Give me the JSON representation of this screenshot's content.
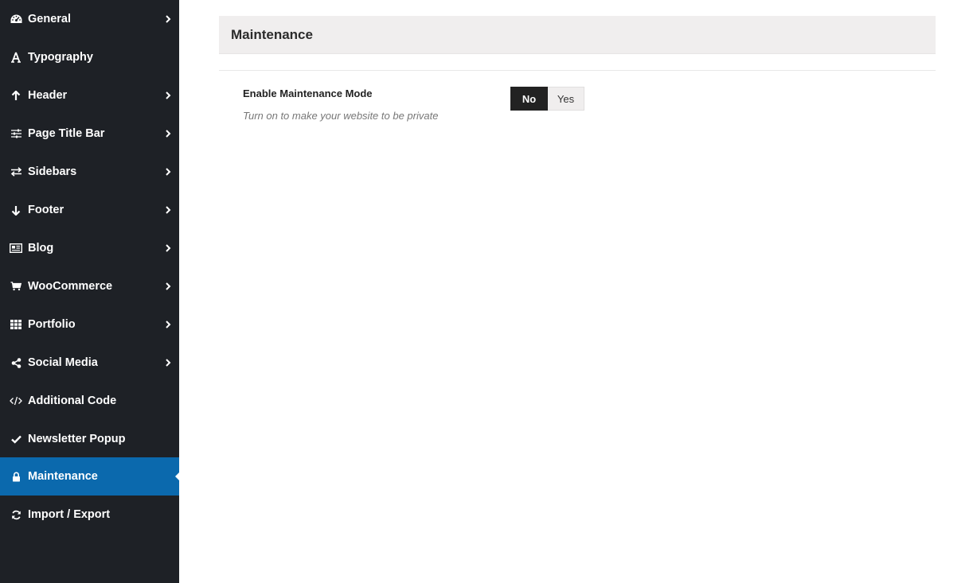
{
  "sidebar": {
    "items": [
      {
        "label": "General",
        "icon": "dashboard-icon",
        "has_submenu": true
      },
      {
        "label": "Typography",
        "icon": "typography-icon",
        "has_submenu": false
      },
      {
        "label": "Header",
        "icon": "arrow-up-icon",
        "has_submenu": true
      },
      {
        "label": "Page Title Bar",
        "icon": "sliders-icon",
        "has_submenu": true
      },
      {
        "label": "Sidebars",
        "icon": "exchange-icon",
        "has_submenu": true
      },
      {
        "label": "Footer",
        "icon": "arrow-down-icon",
        "has_submenu": true
      },
      {
        "label": "Blog",
        "icon": "newspaper-icon",
        "has_submenu": true
      },
      {
        "label": "WooCommerce",
        "icon": "cart-icon",
        "has_submenu": true
      },
      {
        "label": "Portfolio",
        "icon": "grid-icon",
        "has_submenu": true
      },
      {
        "label": "Social Media",
        "icon": "share-icon",
        "has_submenu": true
      },
      {
        "label": "Additional Code",
        "icon": "code-icon",
        "has_submenu": false
      },
      {
        "label": "Newsletter Popup",
        "icon": "check-icon",
        "has_submenu": false
      },
      {
        "label": "Maintenance",
        "icon": "lock-icon",
        "has_submenu": false,
        "active": true
      },
      {
        "label": "Import / Export",
        "icon": "refresh-icon",
        "has_submenu": false
      }
    ]
  },
  "main": {
    "section_title": "Maintenance",
    "field": {
      "label": "Enable Maintenance Mode",
      "description": "Turn on to make your website to be private",
      "options": [
        "No",
        "Yes"
      ],
      "selected": "No"
    }
  },
  "colors": {
    "sidebar_bg": "#1e2126",
    "active_bg": "#0b69ad",
    "toggle_selected": "#222222",
    "header_bg": "#f0eeee"
  }
}
